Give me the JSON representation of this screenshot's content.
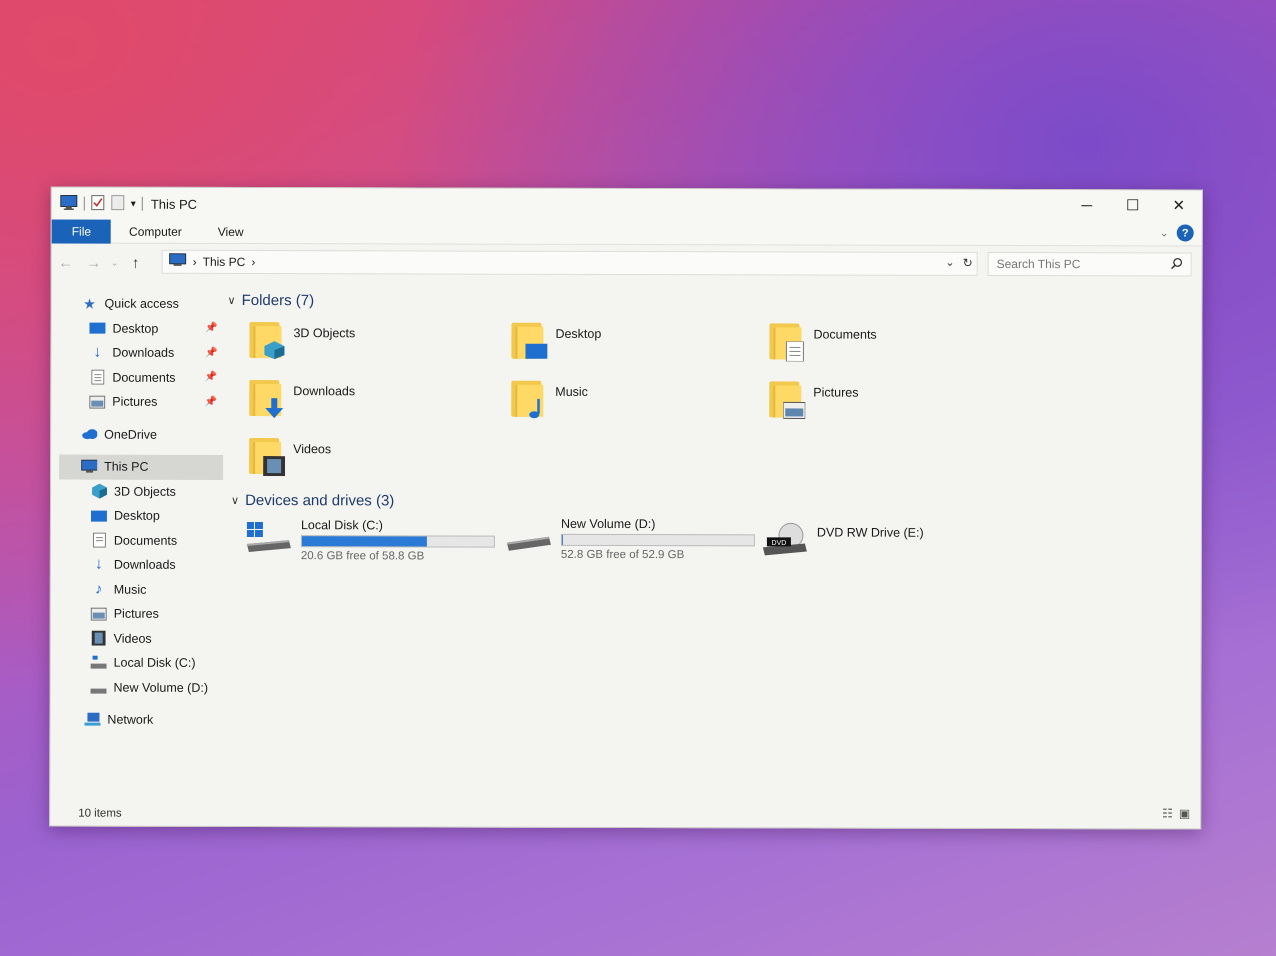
{
  "window": {
    "title": "This PC",
    "minimize": "─",
    "maximize": "☐",
    "close": "✕"
  },
  "ribbon": {
    "tabs": [
      "File",
      "Computer",
      "View"
    ]
  },
  "address": {
    "location": "This PC",
    "separator": "›",
    "search_placeholder": "Search This PC"
  },
  "sidebar": {
    "quick_access": "Quick access",
    "quick_items": [
      "Desktop",
      "Downloads",
      "Documents",
      "Pictures"
    ],
    "onedrive": "OneDrive",
    "this_pc": "This PC",
    "pc_items": [
      "3D Objects",
      "Desktop",
      "Documents",
      "Downloads",
      "Music",
      "Pictures",
      "Videos",
      "Local Disk (C:)",
      "New Volume (D:)"
    ],
    "network": "Network"
  },
  "content": {
    "folders_header": "Folders (7)",
    "folders": [
      "3D Objects",
      "Desktop",
      "Documents",
      "Downloads",
      "Music",
      "Pictures",
      "Videos"
    ],
    "drives_header": "Devices and drives (3)",
    "drives": [
      {
        "name": "Local Disk (C:)",
        "free": "20.6 GB free of 58.8 GB",
        "used_fraction": 0.65
      },
      {
        "name": "New Volume (D:)",
        "free": "52.8 GB free of 52.9 GB",
        "used_fraction": 0.002
      },
      {
        "name": "DVD RW Drive (E:)",
        "dvd_label": "DVD"
      }
    ]
  },
  "status": {
    "items": "10 items"
  },
  "colors": {
    "accent": "#1a63b8",
    "bar_fill": "#2a7ad6",
    "folder": "#ffd966"
  }
}
